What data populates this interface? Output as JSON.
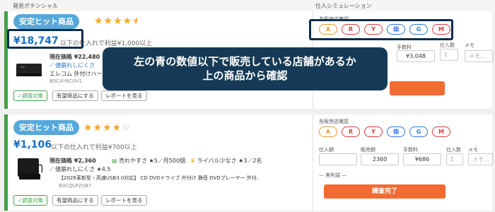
{
  "header": {
    "left_title": "発見ポテンシャル",
    "right_title": "仕入シミュレーション"
  },
  "chip_colors": {
    "A": "#e89a2c",
    "R": "#d83b3b",
    "Y": "#d83b3b",
    "price": "#2f7ad8",
    "G": "#2f7ad8",
    "M": "#d83b3b"
  },
  "products": [
    {
      "badge": "安定ヒット商品",
      "stars": "★★★★",
      "stars_partial": "★",
      "price": "¥18,747",
      "price_note": "以下の仕入れで利益¥1,000以上",
      "current_price": "現在価格 ¥22,480",
      "difficulty": "値崩れしにくさ",
      "title_line": "エレコム 外付けハード",
      "asin": "B0C4Y6C0V1",
      "btn_target": "✓調査対象",
      "btn_wish": "有望商品にする",
      "btn_report": "レポートを見る",
      "store_check_label": "各販売店確認",
      "chips": [
        "A",
        "R",
        "Y",
        "価",
        "G",
        "M"
      ],
      "sim": {
        "fee_label": "手数料",
        "fee_value": "¥3,048",
        "qty_label": "仕入数",
        "qty_value": "1",
        "memo_label": "メモ",
        "memo_placeholder": "メモ..."
      }
    },
    {
      "badge": "安定ヒット商品",
      "stars": "★★★★",
      "stars_empty": "☆",
      "price": "¥1,106",
      "price_note": "以下の仕入れで利益¥700以上",
      "current_price": "現在価格 ¥2,360",
      "sell_ease": "売れやすさ ★5／月500個",
      "rival": "ライバル少なさ ★3／2名",
      "difficulty": "値崩れしにくさ ★4.5",
      "title_line": "【2026革新型・高速USB3.0対応】 CD DVDドライブ 外付け 静音 DVDプレーヤー 外付...",
      "asin": "B0CQLPZSB7",
      "btn_target": "✓調査対象",
      "btn_wish": "有望商品にする",
      "btn_report": "レポートを見る",
      "store_check_label": "各販売店確認",
      "chips": [
        "A",
        "R",
        "Y",
        "価",
        "G",
        "M"
      ],
      "sim": {
        "buy_label": "仕入額",
        "buy_value": "",
        "sell_label": "販売額",
        "sell_value": "2360",
        "fee_label": "手数料",
        "fee_value": "¥686",
        "qty_label": "仕入数",
        "qty_value": "1",
        "memo_label": "メモ",
        "memo_placeholder": "メモ...",
        "profit_label": "— 実利益 —",
        "complete_label": "調査完了"
      }
    }
  ],
  "tooltip": {
    "line1": "左の青の数値以下で販売している店舗があるか",
    "line2": "上の商品から確認"
  }
}
